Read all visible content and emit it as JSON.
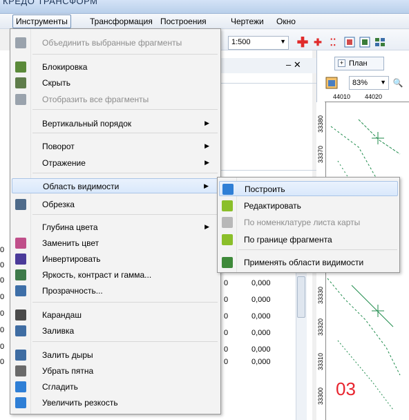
{
  "window": {
    "title_fragment": "КРЕДО ТРАНСФОРМ"
  },
  "menubar": {
    "items": [
      "Инструменты",
      "Трансформация",
      "Построения",
      "Чертежи",
      "Окно"
    ]
  },
  "toolbar": {
    "scale": "1:500"
  },
  "panel": {
    "values": [
      "0,000",
      "0,000",
      "0,000",
      "0,000",
      "0,000",
      "0,000"
    ],
    "left_values": [
      "0",
      "0",
      "0",
      "0",
      "0",
      "0",
      "0",
      "0"
    ]
  },
  "map": {
    "tab_label": "План",
    "zoom": "83%",
    "ruler_top": [
      "44010",
      "44020"
    ],
    "ruler_left": [
      "33380",
      "33370",
      "33330",
      "33320",
      "33310",
      "33300"
    ],
    "overlay_label": "03"
  },
  "dropdown": {
    "items": [
      {
        "label": "Объединить выбранные фрагменты",
        "icon": "merge-fragments-icon",
        "color": "#9aa3ad",
        "disabled": true
      },
      {
        "label": "Блокировка",
        "icon": "lock-icon",
        "color": "#5b8a3a"
      },
      {
        "label": "Скрыть",
        "icon": "hide-icon",
        "color": "#5f7d4b"
      },
      {
        "label": "Отобразить все фрагменты",
        "icon": "show-all-icon",
        "color": "#9aa3ad",
        "disabled": true
      },
      {
        "label": "Вертикальный порядок",
        "submenu": true
      },
      {
        "label": "Поворот",
        "submenu": true
      },
      {
        "label": "Отражение",
        "submenu": true
      },
      {
        "label": "Область видимости",
        "submenu": true,
        "highlighted": true
      },
      {
        "label": "Обрезка",
        "icon": "crop-icon",
        "color": "#4f6b8a"
      },
      {
        "label": "Глубина цвета",
        "submenu": true
      },
      {
        "label": "Заменить цвет",
        "icon": "replace-color-icon",
        "color": "#c04f8a"
      },
      {
        "label": "Инвертировать",
        "icon": "invert-icon",
        "color": "#4b3b9a"
      },
      {
        "label": "Яркость, контраст и гамма...",
        "icon": "brightness-icon",
        "color": "#3e7a4a"
      },
      {
        "label": "Прозрачность...",
        "icon": "transparency-icon",
        "color": "#3e6fa8"
      },
      {
        "label": "Карандаш",
        "icon": "pencil-icon",
        "color": "#4b4b4b"
      },
      {
        "label": "Заливка",
        "icon": "fill-icon",
        "color": "#3f6da3"
      },
      {
        "label": "Залить дыры",
        "icon": "fill-holes-icon",
        "color": "#3f6da3"
      },
      {
        "label": "Убрать пятна",
        "icon": "remove-spots-icon",
        "color": "#6a6a6a"
      },
      {
        "label": "Сгладить",
        "icon": "smooth-icon",
        "color": "#2f7fd6"
      },
      {
        "label": "Увеличить резкость",
        "icon": "sharpen-icon",
        "color": "#2f7fd6"
      }
    ]
  },
  "submenu": {
    "items": [
      {
        "label": "Построить",
        "icon": "build-region-icon",
        "color": "#2f7fd6",
        "highlighted": true
      },
      {
        "label": "Редактировать",
        "icon": "edit-region-icon",
        "color": "#8bbf2a"
      },
      {
        "label": "По номенклатуре листа карты",
        "icon": "sheet-nomenclature-icon",
        "color": "#b8b8b8",
        "disabled": true
      },
      {
        "label": "По границе фрагмента",
        "icon": "fragment-border-icon",
        "color": "#8bbf2a"
      },
      {
        "label": "Применять области видимости",
        "icon": "apply-regions-icon",
        "color": "#3f8a3a"
      }
    ]
  }
}
